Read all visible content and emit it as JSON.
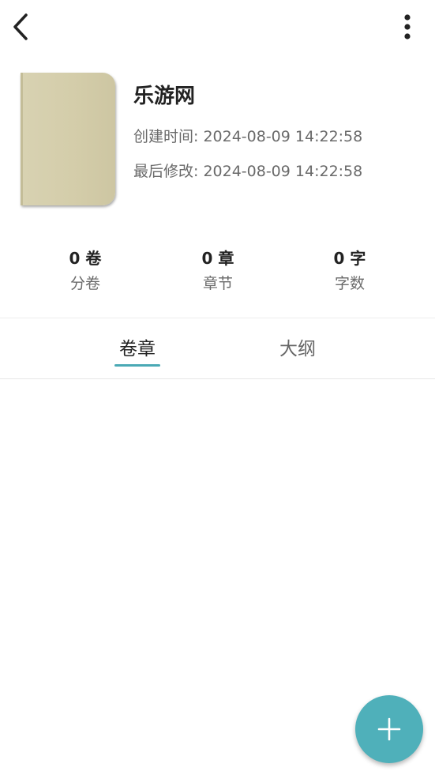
{
  "toolbar": {
    "back_icon": "chevron-left-icon",
    "more_icon": "more-vertical-icon"
  },
  "book": {
    "title": "乐游网",
    "created": "创建时间: 2024-08-09 14:22:58",
    "modified": "最后修改: 2024-08-09 14:22:58",
    "cover_color": "#d4cdaa"
  },
  "stats": [
    {
      "value": "0 卷",
      "label": "分卷"
    },
    {
      "value": "0 章",
      "label": "章节"
    },
    {
      "value": "0 字",
      "label": "字数"
    }
  ],
  "tabs": [
    {
      "label": "卷章",
      "active": true
    },
    {
      "label": "大纲",
      "active": false
    }
  ],
  "fab": {
    "icon": "plus-icon",
    "color": "#4fb0ba"
  },
  "colors": {
    "accent": "#4aa9b5"
  }
}
